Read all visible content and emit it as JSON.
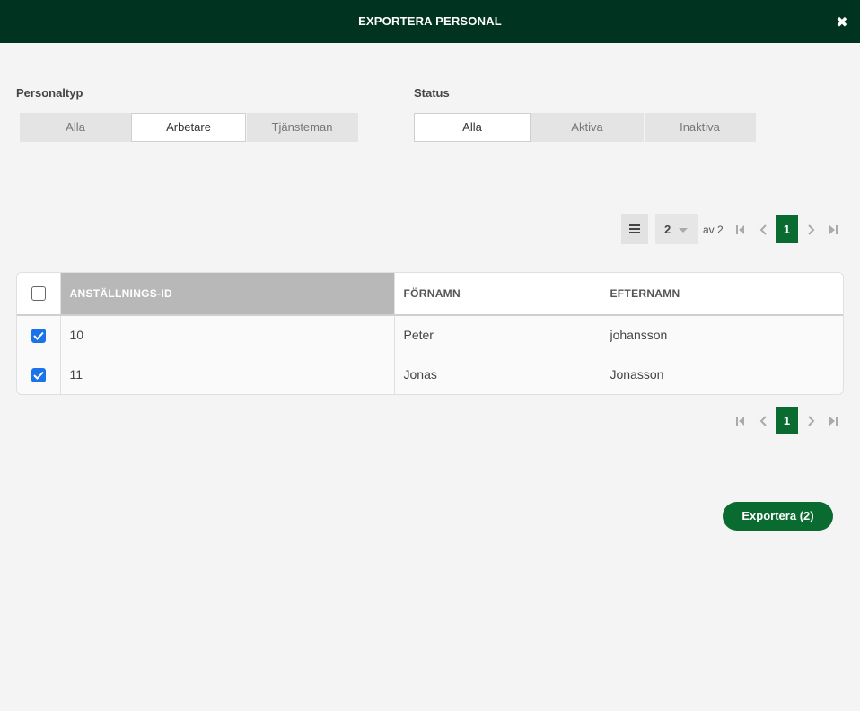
{
  "dialog": {
    "title": "EXPORTERA PERSONAL"
  },
  "filters": {
    "personaltyp": {
      "label": "Personaltyp",
      "options": [
        "Alla",
        "Arbetare",
        "Tjänsteman"
      ],
      "selected": "Arbetare"
    },
    "status": {
      "label": "Status",
      "options": [
        "Alla",
        "Aktiva",
        "Inaktiva"
      ],
      "selected": "Alla"
    }
  },
  "pager": {
    "page_size": "2",
    "of_label": "av 2",
    "current_page": "1"
  },
  "table": {
    "columns": [
      "ANSTÄLLNINGS-ID",
      "FÖRNAMN",
      "EFTERNAMN"
    ],
    "sorted_column": "ANSTÄLLNINGS-ID",
    "select_all_checked": false,
    "rows": [
      {
        "checked": true,
        "id": "10",
        "fornamn": "Peter",
        "efternamn": "johansson"
      },
      {
        "checked": true,
        "id": "11",
        "fornamn": "Jonas",
        "efternamn": "Jonasson"
      }
    ]
  },
  "actions": {
    "export_label": "Exportera (2)"
  },
  "icons": {
    "close": "close-icon",
    "menu": "hamburger-menu-icon",
    "first": "first-page-icon",
    "prev": "previous-page-icon",
    "next": "next-page-icon",
    "last": "last-page-icon",
    "checkbox": "checkbox-icon"
  },
  "colors": {
    "header_bg": "#003320",
    "accent": "#0a6b30",
    "checkbox": "#1a73e8"
  }
}
